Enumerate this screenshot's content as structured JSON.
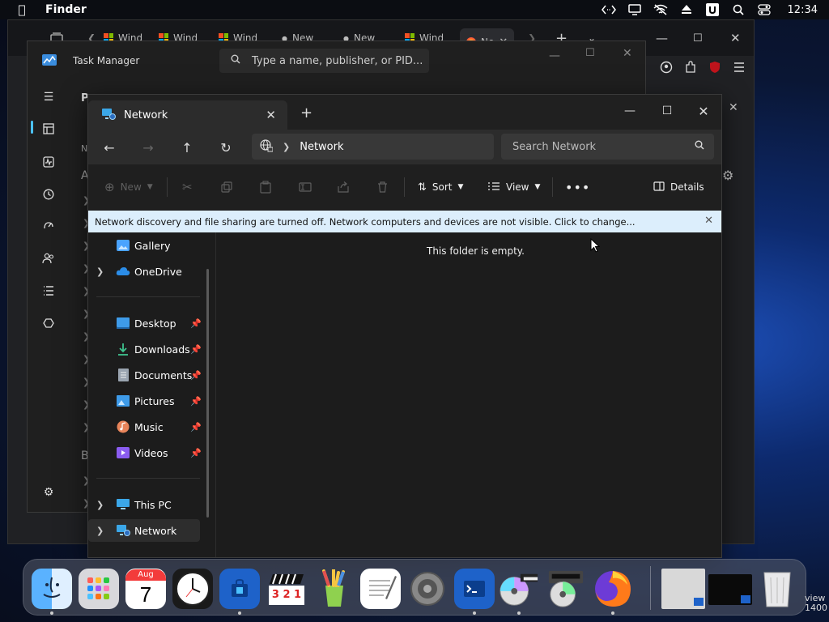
{
  "menubar": {
    "app_name": "Finder",
    "clock": "12:34"
  },
  "browser": {
    "tabs": [
      {
        "label": "Wind"
      },
      {
        "label": "Wind"
      },
      {
        "label": "Wind"
      },
      {
        "label": "New"
      },
      {
        "label": "New"
      },
      {
        "label": "Wind"
      },
      {
        "label": "Ne"
      }
    ]
  },
  "task_manager": {
    "title": "Task Manager",
    "search_placeholder": "Type a name, publisher, or PID...",
    "section_letters": [
      "P",
      "N",
      "A",
      "B"
    ]
  },
  "explorer": {
    "tab_label": "Network",
    "breadcrumb": "Network",
    "search_placeholder": "Search Network",
    "commands": {
      "new": "New",
      "sort": "Sort",
      "view": "View",
      "details": "Details"
    },
    "info_bar": "Network discovery and file sharing are turned off. Network computers and devices are not visible. Click to change...",
    "empty_message": "This folder is empty.",
    "nav_items": [
      {
        "label": "Gallery",
        "icon": "gallery-icon",
        "color": "#4aa3ff"
      },
      {
        "label": "OneDrive",
        "icon": "cloud-icon",
        "color": "#2b8de8"
      },
      {
        "label": "Desktop",
        "icon": "desktop-icon",
        "color": "#3e9be9"
      },
      {
        "label": "Downloads",
        "icon": "download-icon",
        "color": "#3fc48f"
      },
      {
        "label": "Documents",
        "icon": "document-icon",
        "color": "#9aa4b0"
      },
      {
        "label": "Pictures",
        "icon": "pictures-icon",
        "color": "#3e9be9"
      },
      {
        "label": "Music",
        "icon": "music-icon",
        "color": "#e8845a"
      },
      {
        "label": "Videos",
        "icon": "video-icon",
        "color": "#8a5cf0"
      },
      {
        "label": "This PC",
        "icon": "computer-icon",
        "color": "#3ba7e8"
      },
      {
        "label": "Network",
        "icon": "network-icon",
        "color": "#3ba7e8"
      }
    ]
  },
  "dock": {
    "calendar_month": "Aug",
    "calendar_day": "7",
    "clapper_text": "3 2 1",
    "preview_text_1": "view",
    "preview_text_2": "1400"
  },
  "colors": {
    "accent": "#4cc2ff",
    "info_bar_bg": "#dceefc"
  }
}
